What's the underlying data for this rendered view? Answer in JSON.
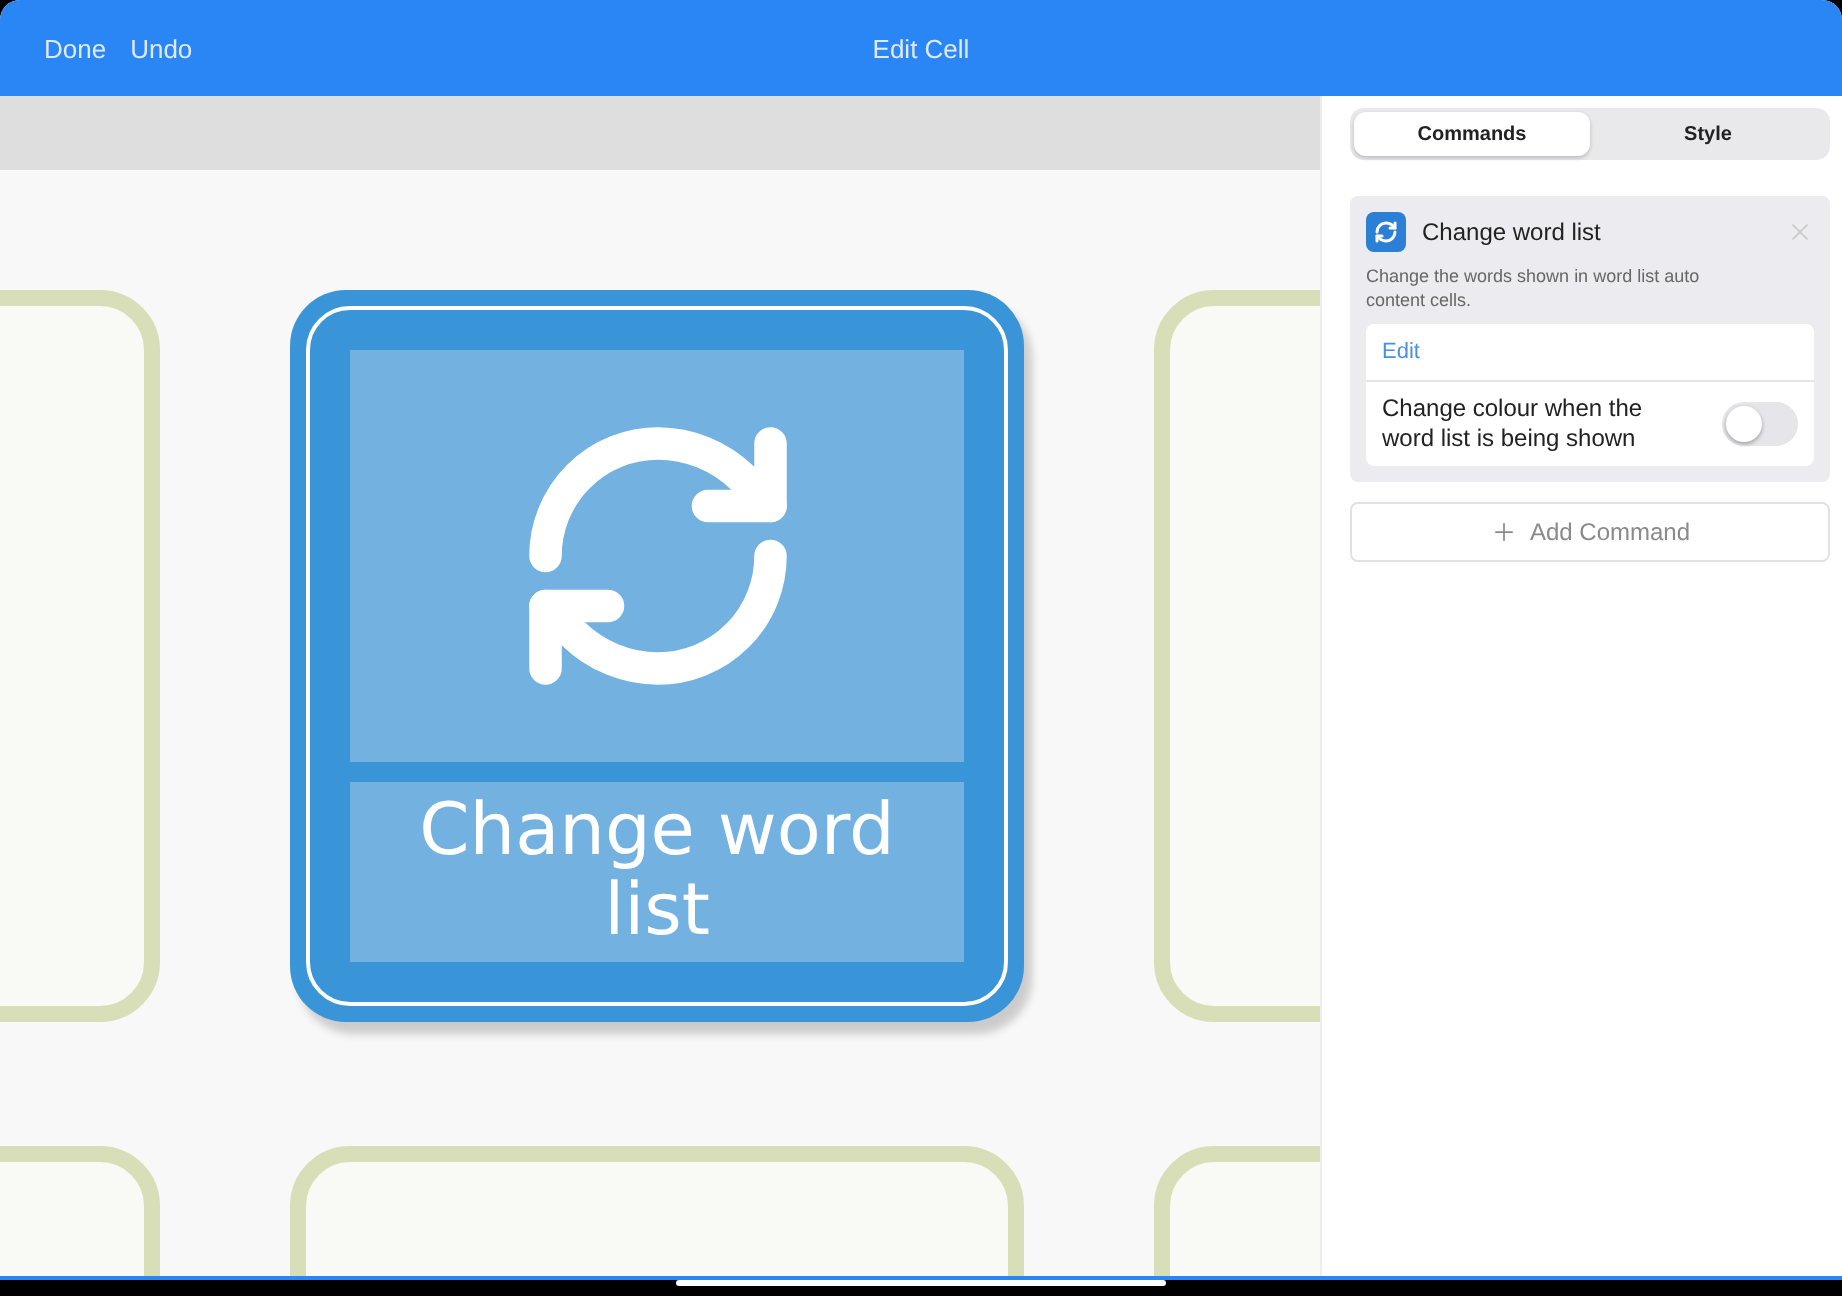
{
  "toolbar": {
    "buttons": [
      {
        "label": "Done"
      },
      {
        "label": "Undo"
      }
    ],
    "title": "Edit Cell"
  },
  "canvas": {
    "cells": [
      {
        "kind": "empty"
      },
      {
        "kind": "button",
        "label": "Change word list"
      },
      {
        "kind": "empty"
      },
      {
        "kind": "empty"
      },
      {
        "kind": "empty"
      },
      {
        "kind": "empty"
      }
    ]
  },
  "inspector": {
    "tabs": [
      {
        "label": "Commands",
        "selected": true
      },
      {
        "label": "Style",
        "selected": false
      }
    ],
    "command": {
      "title": "Change word list",
      "description": "Change the words shown in word list auto content cells.",
      "edit_link": "Edit",
      "option": {
        "label": "Change colour when the word list is being shown",
        "on": false
      }
    },
    "add_button": "Add Command"
  }
}
